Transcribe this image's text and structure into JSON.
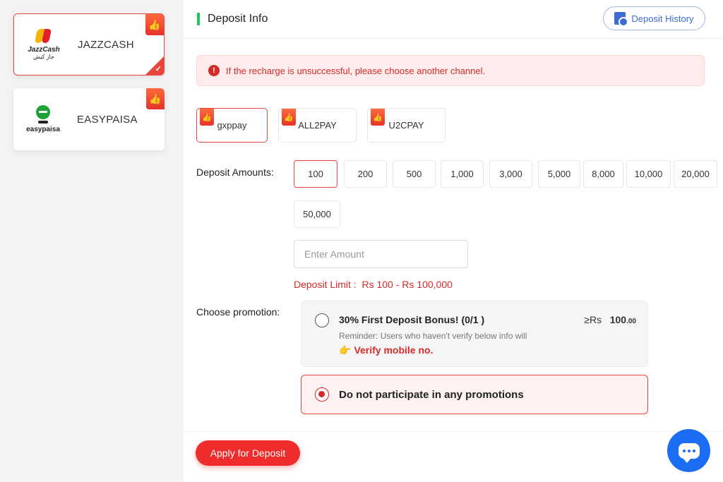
{
  "methods": [
    {
      "name": "JAZZCASH",
      "logo_text": "JazzCash",
      "logo_sub": "جاز کیش",
      "selected": true
    },
    {
      "name": "EASYPAISA",
      "logo_text": "easypaisa",
      "selected": false
    }
  ],
  "header": {
    "title": "Deposit Info",
    "history_label": "Deposit History"
  },
  "alert": {
    "text": "If the recharge is unsuccessful, please choose another channel.",
    "icon": "!"
  },
  "channels": [
    {
      "label": "gxppay",
      "selected": true
    },
    {
      "label": "ALL2PAY",
      "selected": false
    },
    {
      "label": "U2CPAY",
      "selected": false
    }
  ],
  "deposit": {
    "amounts_label": "Deposit Amounts:",
    "amounts": [
      "100",
      "200",
      "500",
      "1,000",
      "3,000",
      "5,000",
      "8,000",
      "10,000",
      "20,000",
      "50,000"
    ],
    "selected_amount": "100",
    "input_placeholder": "Enter Amount",
    "limit_label": "Deposit Limit :",
    "limit_value": "Rs 100 - Rs 100,000"
  },
  "promotion": {
    "label": "Choose promotion:",
    "bonus_title": "30% First Deposit Bonus! (0/1 )",
    "bonus_min_prefix": "≥Rs",
    "bonus_min_value": "100",
    "bonus_min_decimals": ".00",
    "reminder": "Reminder: Users who haven't verify below info will",
    "verify_icon": "👉",
    "verify_label": "Verify mobile no.",
    "none_label": "Do not participate in any promotions",
    "selected": "none"
  },
  "footer": {
    "apply_label": "Apply for Deposit"
  },
  "colors": {
    "accent": "#ee2c2c",
    "link": "#3e6bd4",
    "success_bar": "#22c55e",
    "chat": "#1b6ef3"
  },
  "icons": {
    "thumb": "thumbs-up-icon",
    "check": "check-icon",
    "history": "history-icon",
    "alert": "alert-icon",
    "chat": "chat-icon"
  }
}
